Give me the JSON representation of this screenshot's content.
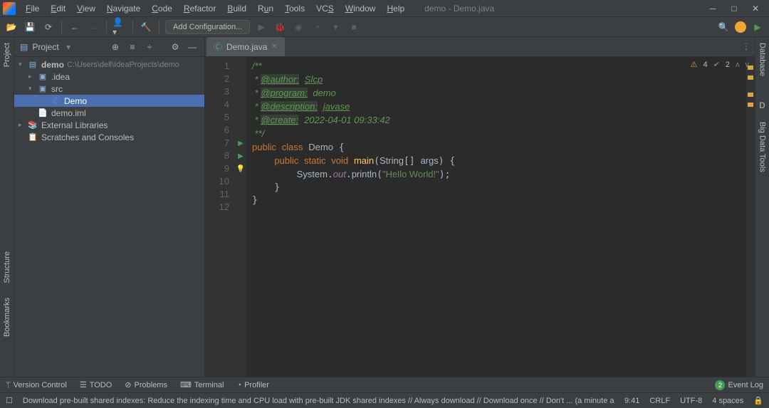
{
  "window": {
    "title": "demo - Demo.java"
  },
  "menu": [
    "File",
    "Edit",
    "View",
    "Navigate",
    "Code",
    "Refactor",
    "Build",
    "Run",
    "Tools",
    "VCS",
    "Window",
    "Help"
  ],
  "toolbar": {
    "config_label": "Add Configuration..."
  },
  "project_panel": {
    "title": "Project",
    "tree": {
      "root": {
        "name": "demo",
        "path": "C:\\Users\\dell\\IdeaProjects\\demo"
      },
      "items": [
        {
          "level": 1,
          "expanded": false,
          "icon": "folder",
          "name": ".idea"
        },
        {
          "level": 1,
          "expanded": true,
          "icon": "folder",
          "name": "src"
        },
        {
          "level": 2,
          "expanded": false,
          "icon": "java",
          "name": "Demo",
          "selected": true
        },
        {
          "level": 1,
          "expanded": false,
          "icon": "file",
          "name": "demo.iml"
        }
      ],
      "ext_libs": "External Libraries",
      "scratches": "Scratches and Consoles"
    }
  },
  "editor": {
    "tab": "Demo.java",
    "gutter_lines": [
      "1",
      "2",
      "3",
      "4",
      "5",
      "6",
      "7",
      "8",
      "9",
      "10",
      "11",
      "12"
    ],
    "gutter_marks": {
      "7": "run",
      "8": "run",
      "9": "bulb"
    },
    "inspections": {
      "warnings": "4",
      "typos": "2"
    },
    "code": {
      "doc_author_tag": "@author:",
      "doc_author_val": "Slcp",
      "doc_program_tag": "@program:",
      "doc_program_val": "demo",
      "doc_desc_tag": "@description:",
      "doc_desc_val": "javase",
      "doc_create_tag": "@create:",
      "doc_create_val": "2022-04-01 09:33:42",
      "kw_public": "public",
      "kw_class": "class",
      "class_name": "Demo",
      "kw_static": "static",
      "kw_void": "void",
      "fn_main": "main",
      "type_string": "String",
      "param": "args",
      "sys": "System",
      "out": "out",
      "println": "println",
      "str_val": "\"Hello World!\""
    }
  },
  "bottom": {
    "version_control": "Version Control",
    "todo": "TODO",
    "problems": "Problems",
    "terminal": "Terminal",
    "profiler": "Profiler",
    "event_log": "Event Log"
  },
  "status": {
    "msg": "Download pre-built shared indexes: Reduce the indexing time and CPU load with pre-built JDK shared indexes // Always download // Download once // Don't ... (a minute a",
    "pos": "9:41",
    "eol": "CRLF",
    "encoding": "UTF-8",
    "indent": "4 spaces"
  },
  "left_tools": [
    "Project",
    "Structure",
    "Bookmarks"
  ],
  "right_tools": [
    "Database",
    "Big Data Tools"
  ]
}
